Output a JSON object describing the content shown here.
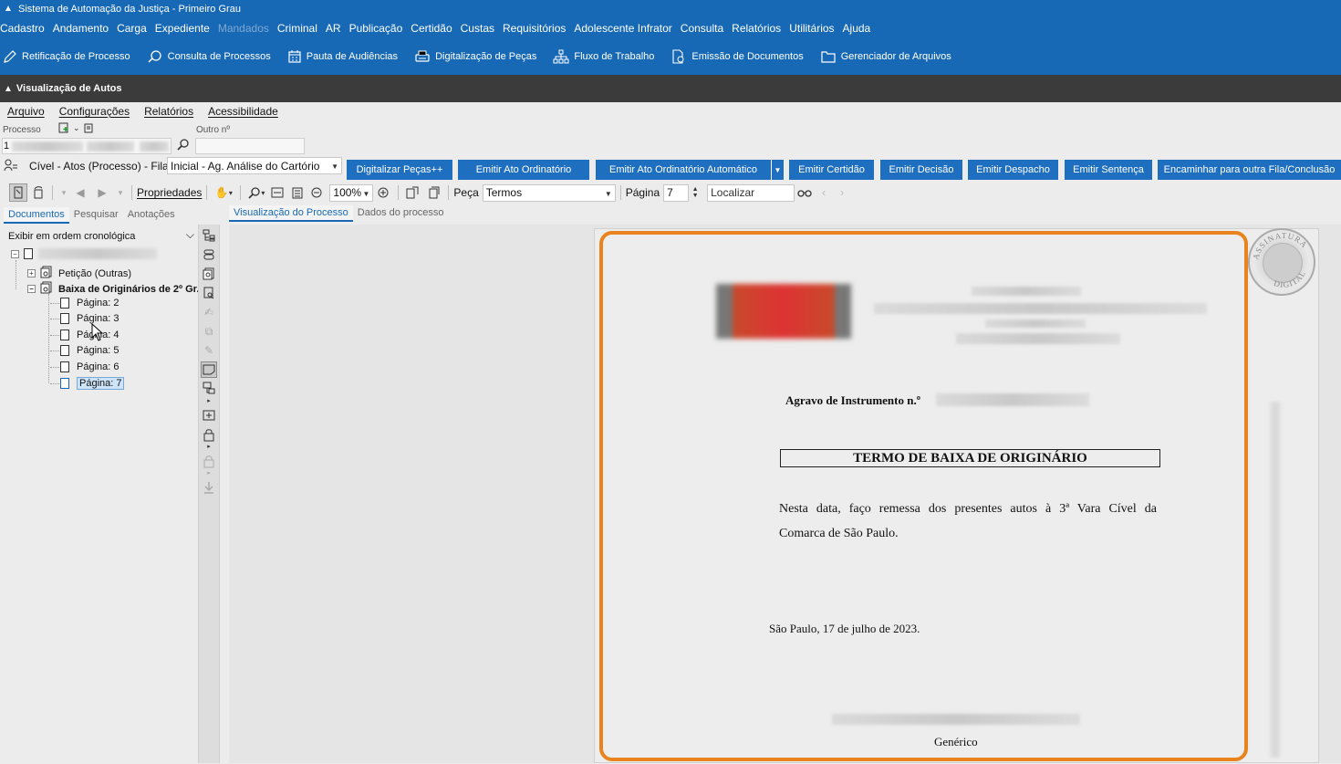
{
  "app": {
    "title": "Sistema de Automação da Justiça - Primeiro Grau",
    "brand_color": "#1769b5",
    "highlight_color": "#e8831e"
  },
  "menu": {
    "items": [
      {
        "label": "Cadastro",
        "enabled": true
      },
      {
        "label": "Andamento",
        "enabled": true
      },
      {
        "label": "Carga",
        "enabled": true
      },
      {
        "label": "Expediente",
        "enabled": true
      },
      {
        "label": "Mandados",
        "enabled": false
      },
      {
        "label": "Criminal",
        "enabled": true
      },
      {
        "label": "AR",
        "enabled": true
      },
      {
        "label": "Publicação",
        "enabled": true
      },
      {
        "label": "Certidão",
        "enabled": true
      },
      {
        "label": "Custas",
        "enabled": true
      },
      {
        "label": "Requisitórios",
        "enabled": true
      },
      {
        "label": "Adolescente Infrator",
        "enabled": true
      },
      {
        "label": "Consulta",
        "enabled": true
      },
      {
        "label": "Relatórios",
        "enabled": true
      },
      {
        "label": "Utilitários",
        "enabled": true
      },
      {
        "label": "Ajuda",
        "enabled": true
      }
    ]
  },
  "toolbar": {
    "items": [
      {
        "label": "Retificação de Processo",
        "icon": "edit-icon"
      },
      {
        "label": "Consulta de Processos",
        "icon": "search-icon"
      },
      {
        "label": "Pauta de Audiências",
        "icon": "calendar-icon"
      },
      {
        "label": "Digitalização de Peças",
        "icon": "scanner-icon"
      },
      {
        "label": "Fluxo de Trabalho",
        "icon": "workflow-icon"
      },
      {
        "label": "Emissão de Documentos",
        "icon": "document-gear-icon"
      },
      {
        "label": "Gerenciador de Arquivos",
        "icon": "folder-icon"
      }
    ]
  },
  "window": {
    "title": "Visualização de Autos"
  },
  "submenu": {
    "items": [
      "Arquivo",
      "Configurações",
      "Relatórios",
      "Acessibilidade"
    ]
  },
  "process": {
    "label": "Processo",
    "other_label": "Outro nº",
    "number_prefix": "1"
  },
  "queue": {
    "text": "Cível - Atos (Processo) - Fila:",
    "value": "Inicial - Ag. Análise do Cartório"
  },
  "actions": [
    "Digitalizar Peças++",
    "Emitir Ato Ordinatório",
    "Emitir Ato Ordinatório Automático",
    "Emitir Certidão",
    "Emitir Decisão",
    "Emitir Despacho",
    "Emitir Sentença",
    "Encaminhar para outra Fila/Conclusão"
  ],
  "viewer_toolbar": {
    "properties_label": "Propriedades",
    "zoom": "100%",
    "piece_label": "Peça",
    "piece_value": "Termos",
    "page_label": "Página",
    "page_value": "7",
    "find_placeholder": "Localizar"
  },
  "left_tabs": [
    "Documentos",
    "Pesquisar",
    "Anotações"
  ],
  "left_tabs_active": 0,
  "sort_select": "Exibir em ordem cronológica",
  "tree": {
    "docs": [
      "Petição (Outras)",
      "Baixa de Originários de 2º Gr."
    ],
    "pages": [
      "Página: 2",
      "Página: 3",
      "Página: 4",
      "Página: 5",
      "Página: 6",
      "Página: 7"
    ],
    "selected_page": "Página: 7"
  },
  "view_tabs": [
    "Visualização do Processo",
    "Dados do processo"
  ],
  "document": {
    "case_line": "Agravo de Instrumento n.º",
    "heading": "TERMO DE BAIXA DE ORIGINÁRIO",
    "body_line1": "Nesta data, faço remessa dos presentes autos à 3ª Vara Cível da",
    "body_line2": "Comarca de São Paulo.",
    "date_line": "São Paulo, 17 de julho de 2023.",
    "signature": "Genérico",
    "stamp_top": "ASSINATURA",
    "stamp_bottom": "DIGITAL"
  }
}
